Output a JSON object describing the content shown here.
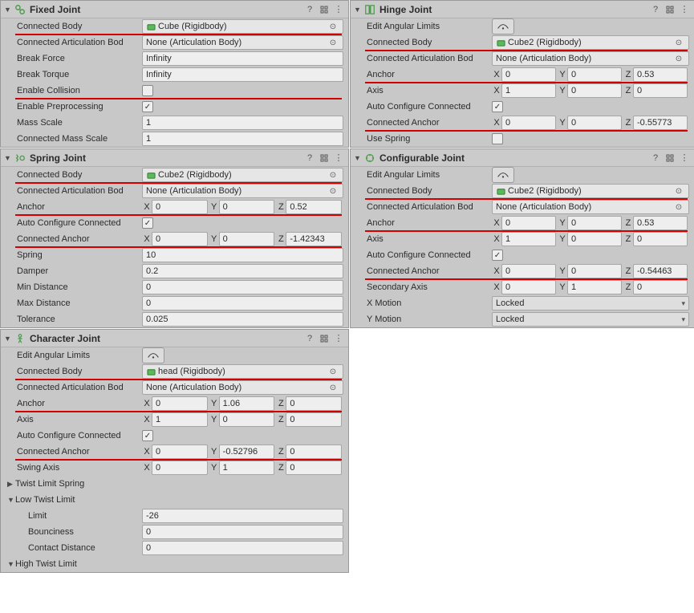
{
  "fixed": {
    "title": "Fixed Joint",
    "connectedBody": {
      "label": "Connected Body",
      "value": "Cube (Rigidbody)"
    },
    "connectedArticulation": {
      "label": "Connected Articulation Bod",
      "value": "None (Articulation Body)"
    },
    "breakForce": {
      "label": "Break Force",
      "value": "Infinity"
    },
    "breakTorque": {
      "label": "Break Torque",
      "value": "Infinity"
    },
    "enableCollision": {
      "label": "Enable Collision",
      "checked": false
    },
    "enablePreprocessing": {
      "label": "Enable Preprocessing",
      "checked": true
    },
    "massScale": {
      "label": "Mass Scale",
      "value": "1"
    },
    "connectedMassScale": {
      "label": "Connected Mass Scale",
      "value": "1"
    }
  },
  "hinge": {
    "title": "Hinge Joint",
    "editLimits": "Edit Angular Limits",
    "connectedBody": {
      "label": "Connected Body",
      "value": "Cube2 (Rigidbody)"
    },
    "connectedArticulation": {
      "label": "Connected Articulation Bod",
      "value": "None (Articulation Body)"
    },
    "anchor": {
      "label": "Anchor",
      "x": "0",
      "y": "0",
      "z": "0.53"
    },
    "axis": {
      "label": "Axis",
      "x": "1",
      "y": "0",
      "z": "0"
    },
    "autoConfigure": {
      "label": "Auto Configure Connected",
      "checked": true
    },
    "connectedAnchor": {
      "label": "Connected Anchor",
      "x": "0",
      "y": "0",
      "z": "-0.55773"
    },
    "useSpring": {
      "label": "Use Spring",
      "checked": false
    }
  },
  "spring": {
    "title": "Spring Joint",
    "connectedBody": {
      "label": "Connected Body",
      "value": "Cube2 (Rigidbody)"
    },
    "connectedArticulation": {
      "label": "Connected Articulation Bod",
      "value": "None (Articulation Body)"
    },
    "anchor": {
      "label": "Anchor",
      "x": "0",
      "y": "0",
      "z": "0.52"
    },
    "autoConfigure": {
      "label": "Auto Configure Connected",
      "checked": true
    },
    "connectedAnchor": {
      "label": "Connected Anchor",
      "x": "0",
      "y": "0",
      "z": "-1.42343"
    },
    "springVal": {
      "label": "Spring",
      "value": "10"
    },
    "damper": {
      "label": "Damper",
      "value": "0.2"
    },
    "minDistance": {
      "label": "Min Distance",
      "value": "0"
    },
    "maxDistance": {
      "label": "Max Distance",
      "value": "0"
    },
    "tolerance": {
      "label": "Tolerance",
      "value": "0.025"
    }
  },
  "configurable": {
    "title": "Configurable Joint",
    "editLimits": "Edit Angular Limits",
    "connectedBody": {
      "label": "Connected Body",
      "value": "Cube2 (Rigidbody)"
    },
    "connectedArticulation": {
      "label": "Connected Articulation Bod",
      "value": "None (Articulation Body)"
    },
    "anchor": {
      "label": "Anchor",
      "x": "0",
      "y": "0",
      "z": "0.53"
    },
    "axis": {
      "label": "Axis",
      "x": "1",
      "y": "0",
      "z": "0"
    },
    "autoConfigure": {
      "label": "Auto Configure Connected",
      "checked": true
    },
    "connectedAnchor": {
      "label": "Connected Anchor",
      "x": "0",
      "y": "0",
      "z": "-0.54463"
    },
    "secondaryAxis": {
      "label": "Secondary Axis",
      "x": "0",
      "y": "1",
      "z": "0"
    },
    "xMotion": {
      "label": "X Motion",
      "value": "Locked"
    },
    "yMotion": {
      "label": "Y Motion",
      "value": "Locked"
    }
  },
  "character": {
    "title": "Character Joint",
    "editLimits": "Edit Angular Limits",
    "connectedBody": {
      "label": "Connected Body",
      "value": "head (Rigidbody)"
    },
    "connectedArticulation": {
      "label": "Connected Articulation Bod",
      "value": "None (Articulation Body)"
    },
    "anchor": {
      "label": "Anchor",
      "x": "0",
      "y": "1.06",
      "z": "0"
    },
    "axis": {
      "label": "Axis",
      "x": "1",
      "y": "0",
      "z": "0"
    },
    "autoConfigure": {
      "label": "Auto Configure Connected",
      "checked": true
    },
    "connectedAnchor": {
      "label": "Connected Anchor",
      "x": "0",
      "y": "-0.52796",
      "z": "0"
    },
    "swingAxis": {
      "label": "Swing Axis",
      "x": "0",
      "y": "1",
      "z": "0"
    },
    "twistLimitSpring": "Twist Limit Spring",
    "lowTwistLimit": "Low Twist Limit",
    "limit": {
      "label": "Limit",
      "value": "-26"
    },
    "bounciness": {
      "label": "Bounciness",
      "value": "0"
    },
    "contactDistance": {
      "label": "Contact Distance",
      "value": "0"
    },
    "highTwistLimit": "High Twist Limit"
  },
  "common": {
    "xLabel": "X",
    "yLabel": "Y",
    "zLabel": "Z"
  }
}
